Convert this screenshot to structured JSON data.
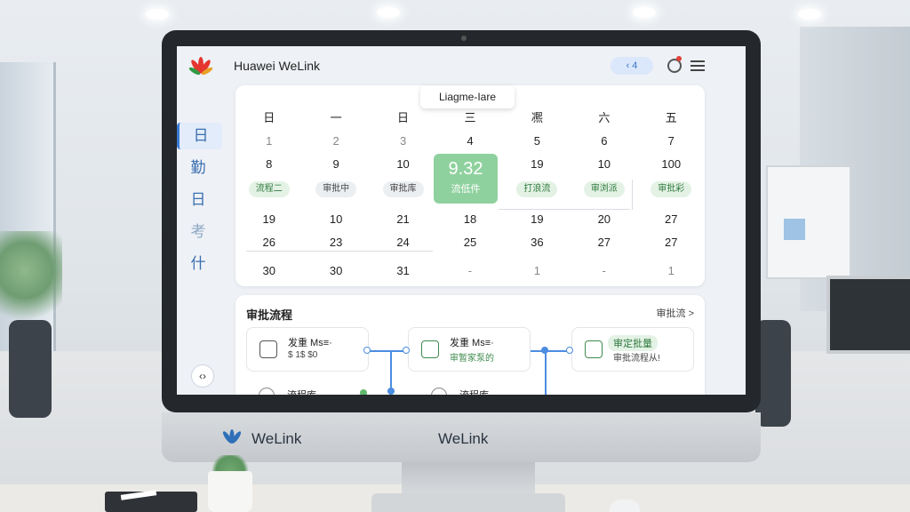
{
  "window": {
    "app_title": "Huawei WeLink",
    "pill_label": "‹ 4"
  },
  "sidebar": {
    "items": [
      {
        "label": "日"
      },
      {
        "label": "勤"
      },
      {
        "label": "日"
      },
      {
        "label": "考"
      },
      {
        "label": "什"
      }
    ],
    "bottom_label": "‹›"
  },
  "calendar": {
    "tooltip": "Liagme-Iare",
    "weekdays": [
      "日",
      "一",
      "日",
      "三",
      "凞",
      "六",
      "五"
    ],
    "rows": [
      [
        "1",
        "2",
        "3",
        "4",
        "5",
        "6",
        "7"
      ],
      [
        "8",
        "9",
        "10",
        "",
        "19",
        "10",
        "100"
      ],
      [
        "19",
        "10",
        "21",
        "18",
        "19",
        "20",
        "27"
      ],
      [
        "26",
        "23",
        "24",
        "25",
        "36",
        "27",
        "27"
      ],
      [
        "30",
        "30",
        "31",
        "-",
        "1",
        "-",
        "1"
      ]
    ],
    "tags": [
      "流程二",
      "审批中",
      "审批库",
      "",
      "打浪流",
      "审浏派",
      "审批彩"
    ],
    "highlight": {
      "value": "9.32",
      "sub": "流低件"
    }
  },
  "flow": {
    "title": "审批流程",
    "more": "审批流 >",
    "boxes": [
      {
        "t1": "发重 Ms≡·",
        "t2": "$ 1$ $0"
      },
      {
        "t1": "发重 Ms≡·",
        "t2": "审暂家泵的"
      },
      {
        "t1": "审定批量",
        "t2": "审批流程从!"
      }
    ],
    "lower": [
      {
        "t1": "流程库"
      },
      {
        "t1": "流程库"
      }
    ]
  },
  "chin": {
    "brand_left": "WeLink",
    "brand_center": "WeLink"
  },
  "colors": {
    "accent": "#3a7bd5",
    "success": "#8fd19e",
    "alert": "#e0413b"
  }
}
